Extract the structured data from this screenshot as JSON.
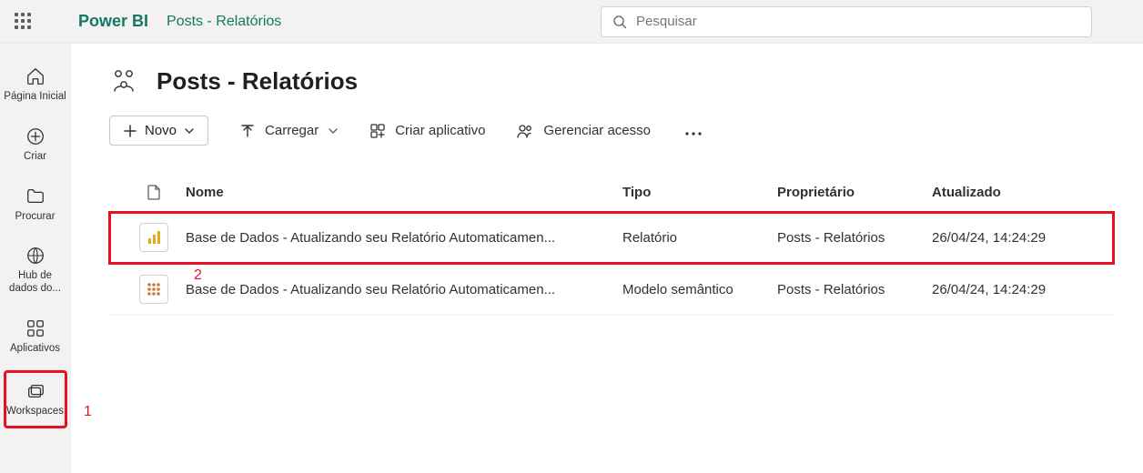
{
  "header": {
    "brand": "Power BI",
    "breadcrumb": "Posts - Relatórios",
    "search_placeholder": "Pesquisar"
  },
  "nav": {
    "home": "Página Inicial",
    "create": "Criar",
    "browse": "Procurar",
    "datahub": "Hub de dados do...",
    "apps": "Aplicativos",
    "workspaces": "Workspaces"
  },
  "workspace": {
    "title": "Posts - Relatórios"
  },
  "toolbar": {
    "new": "Novo",
    "upload": "Carregar",
    "create_app": "Criar aplicativo",
    "manage_access": "Gerenciar acesso"
  },
  "table": {
    "headers": {
      "name": "Nome",
      "type": "Tipo",
      "owner": "Proprietário",
      "updated": "Atualizado"
    },
    "rows": [
      {
        "name": "Base de Dados - Atualizando seu Relatório Automaticamen...",
        "type": "Relatório",
        "owner": "Posts - Relatórios",
        "updated": "26/04/24, 14:24:29"
      },
      {
        "name": "Base de Dados - Atualizando seu Relatório Automaticamen...",
        "type": "Modelo semântico",
        "owner": "Posts - Relatórios",
        "updated": "26/04/24, 14:24:29"
      }
    ]
  },
  "annotations": {
    "one": "1",
    "two": "2"
  }
}
